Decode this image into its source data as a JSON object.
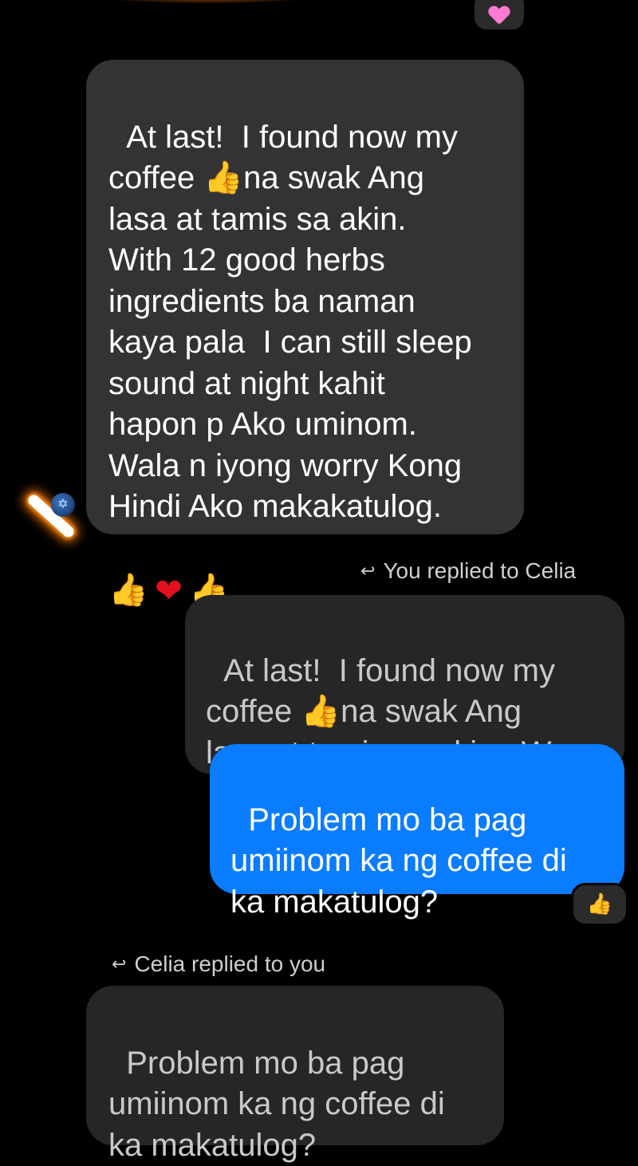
{
  "messages": {
    "incoming_main": {
      "text": "At last!  I found now my\ncoffee ",
      "thumb_icon": "thumbs-up",
      "text_after_thumb": "na swak Ang\nlasa at tamis sa akin.\nWith 12 good herbs\ningredients ba naman\nkaya pala  I can still sleep\nsound at night kahit\nhapon p Ako uminom.\nWala n iyong worry Kong\nHindi Ako makakatulog.",
      "emoji_row": [
        "thumbs-up",
        "red-heart",
        "thumbs-up"
      ],
      "reaction_top": "pink-heart"
    },
    "reply_you_label": "You replied to Celia",
    "quoted_out": {
      "text_before_thumb": "At last!  I found now my\ncoffee ",
      "thumb_icon": "thumbs-up",
      "text_after_thumb": "na swak Ang\nlasa at tamis sa akin.  W..."
    },
    "outgoing": {
      "text": "Problem mo ba pag\numiinom ka ng coffee di\nka makatulog?",
      "reaction": "thumbs-up"
    },
    "reply_celia_label": "Celia replied to you",
    "quoted_in": {
      "text": "Problem mo ba pag\numiinom ka ng coffee di\nka makatulog?"
    }
  },
  "colors": {
    "background": "#000000",
    "incoming_bubble": "#333336",
    "quoted_bubble": "#262628",
    "outgoing_bubble": "#0a7cff"
  }
}
